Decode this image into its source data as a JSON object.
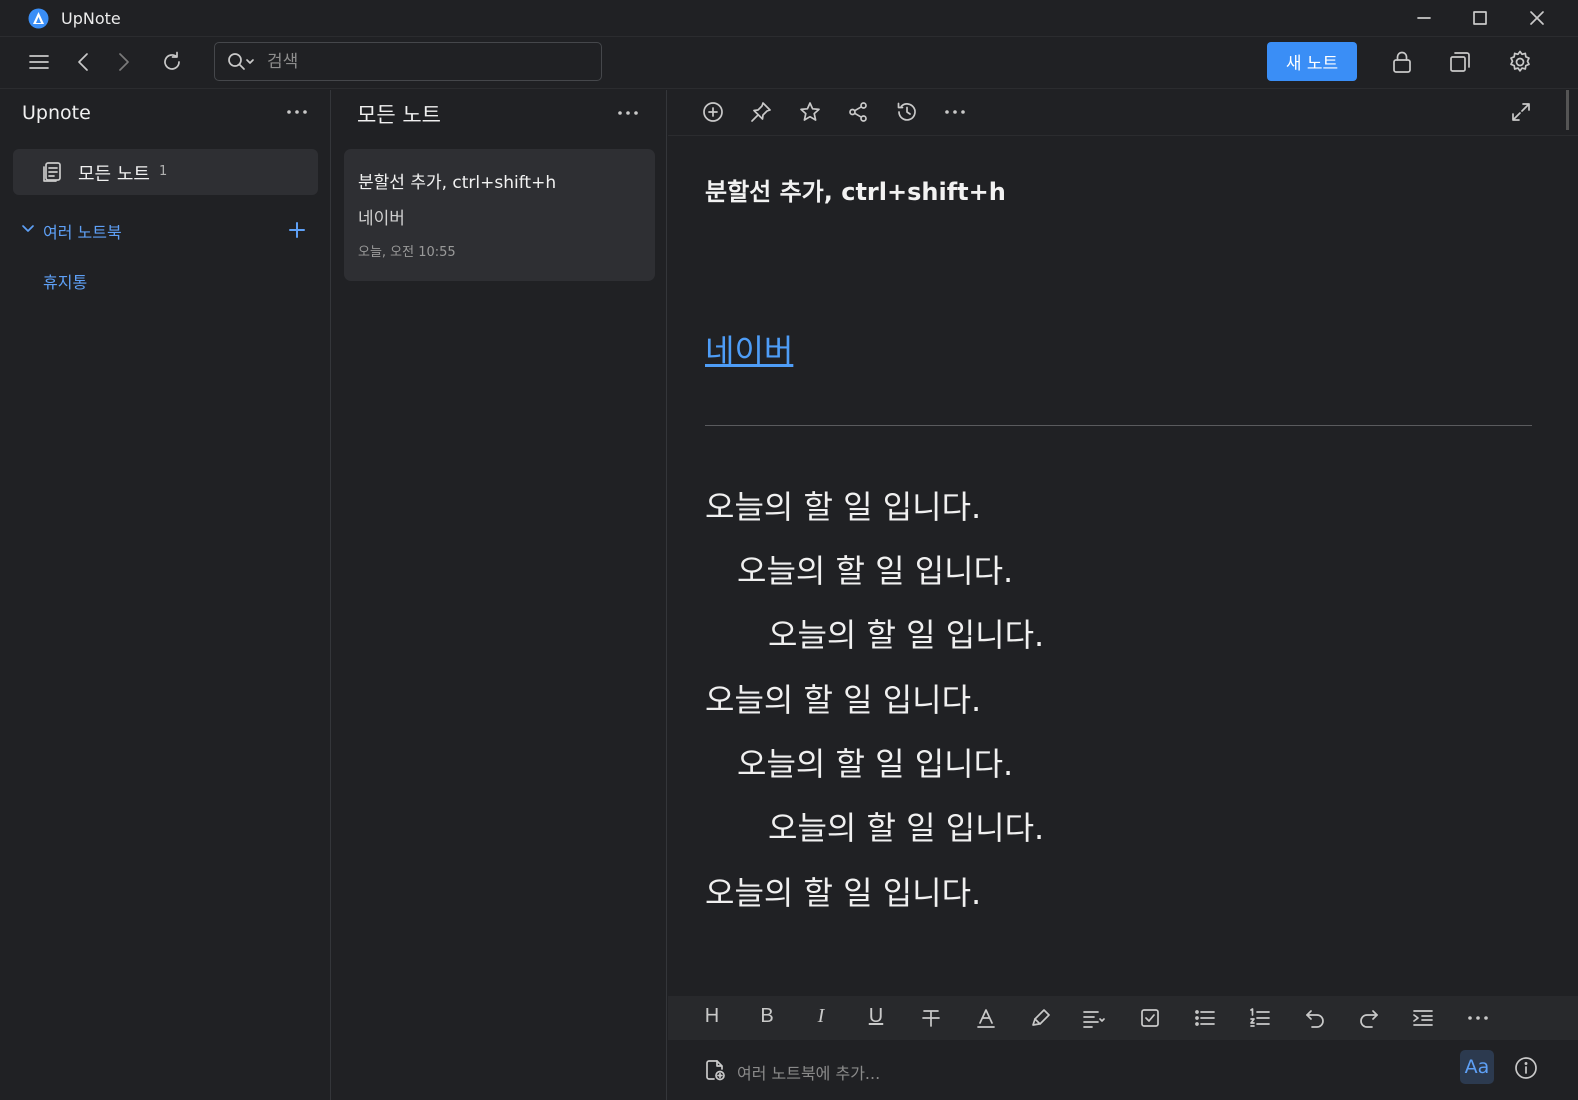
{
  "window": {
    "title": "UpNote",
    "icons": [
      "app-logo-icon",
      "minimize-icon",
      "maximize-icon",
      "close-icon"
    ]
  },
  "toolbar": {
    "search_placeholder": "검색",
    "new_note_label": "새 노트",
    "icons": [
      "menu-icon",
      "back-icon",
      "forward-icon",
      "refresh-icon",
      "search-icon",
      "lock-icon",
      "new-window-icon",
      "gear-icon"
    ]
  },
  "sidebar": {
    "title": "Upnote",
    "all_notes_label": "모든 노트",
    "all_notes_count": "1",
    "notebooks_label": "여러 노트북",
    "trash_label": "휴지통"
  },
  "notelist": {
    "title": "모든 노트",
    "notes": [
      {
        "title": "분할선 추가, ctrl+shift+h",
        "preview": "네이버",
        "date": "오늘, 오전 10:55"
      }
    ]
  },
  "editor": {
    "heading": "분할선 추가, ctrl+shift+h",
    "link_text": "네이버",
    "lines": [
      {
        "text": "오늘의 할 일 입니다.",
        "indent": 0
      },
      {
        "text": "오늘의 할 일 입니다.",
        "indent": 1
      },
      {
        "text": "오늘의 할 일 입니다.",
        "indent": 2
      },
      {
        "text": "오늘의 할 일 입니다.",
        "indent": 0
      },
      {
        "text": "오늘의 할 일 입니다.",
        "indent": 1
      },
      {
        "text": "오늘의 할 일 입니다.",
        "indent": 2
      },
      {
        "text": "오늘의 할 일 입니다.",
        "indent": 0
      }
    ],
    "toolbar_icons": [
      "add-circle-icon",
      "pin-icon",
      "star-icon",
      "share-icon",
      "history-icon",
      "more-icon",
      "expand-icon"
    ]
  },
  "format_bar": {
    "heading_label": "H",
    "bold_label": "B",
    "italic_label": "I",
    "underline_label": "U",
    "icons": [
      "strikethrough-icon",
      "text-color-icon",
      "highlight-icon",
      "align-icon",
      "checkbox-icon",
      "bullet-list-icon",
      "numbered-list-icon",
      "undo-icon",
      "redo-icon",
      "indent-icon",
      "more-icon"
    ]
  },
  "notebook_bar": {
    "placeholder": "여러 노트북에 추가...",
    "font_button_label": "Aa"
  },
  "colors": {
    "accent": "#3a8ef6",
    "link": "#4e9df7",
    "background": "#202124",
    "card": "#2e2f33"
  }
}
